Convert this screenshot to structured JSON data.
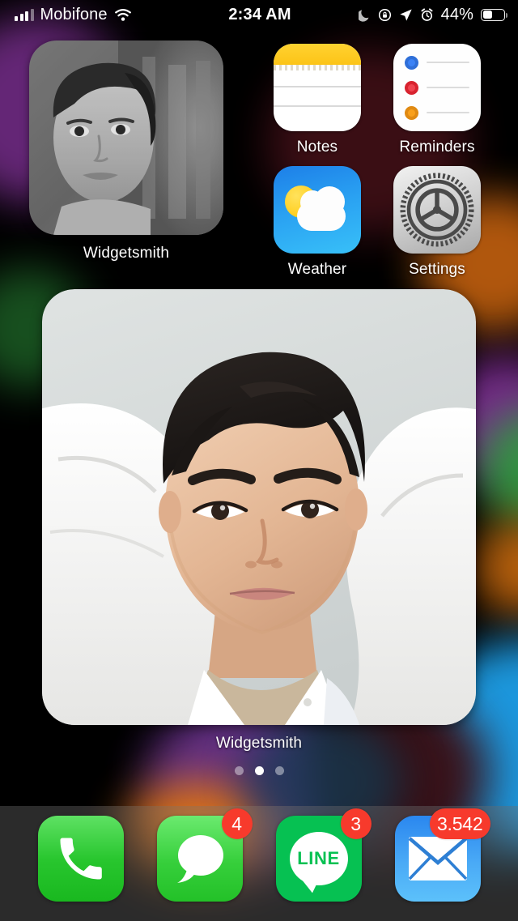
{
  "status_bar": {
    "carrier": "Mobifone",
    "signal_icon": "cellular-signal-bars-icon",
    "wifi_icon": "wifi-icon",
    "time": "2:34 AM",
    "do_not_disturb_icon": "moon-icon",
    "rotation_lock_icon": "rotation-lock-icon",
    "location_icon": "location-arrow-icon",
    "alarm_icon": "alarm-clock-icon",
    "battery_percent": "44%",
    "battery_level": 44,
    "battery_icon": "battery-icon"
  },
  "widgets": {
    "small": {
      "label": "Widgetsmith",
      "photo_alt": "black-and-white portrait photo"
    },
    "large": {
      "label": "Widgetsmith",
      "photo_alt": "portrait photo of man in white jacket"
    }
  },
  "apps": [
    {
      "name": "Notes",
      "icon": "notes-icon"
    },
    {
      "name": "Reminders",
      "icon": "reminders-icon"
    },
    {
      "name": "Weather",
      "icon": "weather-icon"
    },
    {
      "name": "Settings",
      "icon": "settings-gear-icon"
    }
  ],
  "page_dots": {
    "count": 3,
    "active_index": 1
  },
  "dock": [
    {
      "name": "Phone",
      "icon": "phone-handset-icon",
      "badge": ""
    },
    {
      "name": "Messages",
      "icon": "message-bubble-icon",
      "badge": "4"
    },
    {
      "name": "LINE",
      "icon": "line-app-icon",
      "badge": "3",
      "glyph_text": "LINE"
    },
    {
      "name": "Mail",
      "icon": "mail-envelope-icon",
      "badge": "3.542"
    }
  ],
  "colors": {
    "background": "#000000",
    "badge_red": "#f73a2c",
    "dock_tint": "rgba(118,118,120,0.36)",
    "bokeh_purple": "#7b2d8f",
    "bokeh_blue": "#1e9fe8",
    "bokeh_green": "#2f9e3e",
    "bokeh_orange": "#e07410",
    "bokeh_maroon": "#3a0d12",
    "notes_yellow": "#fcc417",
    "weather_blue": "#2aa2f2",
    "accent_white": "#ffffff"
  }
}
